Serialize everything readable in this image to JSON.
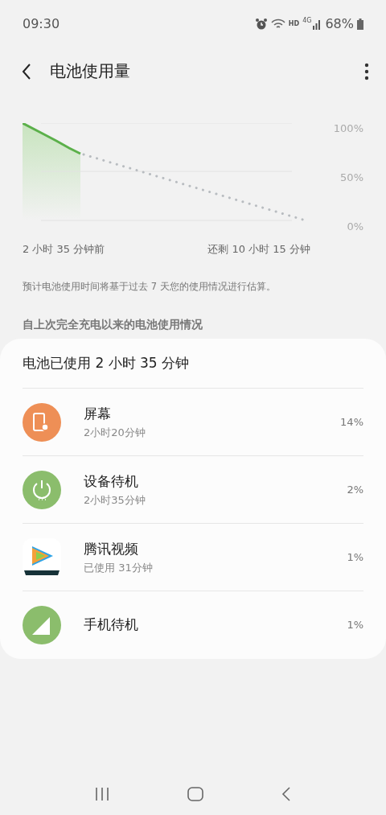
{
  "status_bar": {
    "time": "09:30",
    "network": "HD",
    "generation": "4G",
    "battery": "68%"
  },
  "header": {
    "title": "电池使用量"
  },
  "chart": {
    "y_labels": [
      "100%",
      "50%",
      "0%"
    ],
    "start_label": "2 小时 35 分钟前",
    "end_label": "还剩 10 小时 15 分钟"
  },
  "note": "预计电池使用时间将基于过去 7 天您的使用情况进行估算。",
  "section_title": "自上次完全充电以来的电池使用情况",
  "usage": {
    "summary": "电池已使用 2 小时 35 分钟",
    "items": [
      {
        "kind": "screen",
        "name": "屏幕",
        "detail": "2小时20分钟",
        "percent": "14%"
      },
      {
        "kind": "power",
        "name": "设备待机",
        "detail": "2小时35分钟",
        "percent": "2%"
      },
      {
        "kind": "app",
        "name": "腾讯视频",
        "detail": "已使用 31分钟",
        "percent": "1%"
      },
      {
        "kind": "signal",
        "name": "手机待机",
        "percent": "1%"
      }
    ]
  }
}
